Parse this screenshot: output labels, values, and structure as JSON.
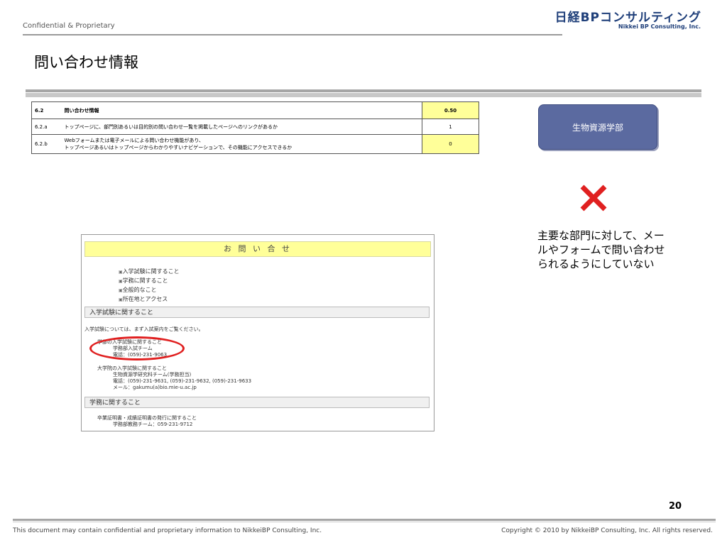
{
  "header": {
    "confidential": "Confidential & Proprietary",
    "logo_jp": "日経BPコンサルティング",
    "logo_en": "Nikkei BP Consulting, Inc."
  },
  "page_title": "問い合わせ情報",
  "criteria": [
    {
      "id": "6.2",
      "text1": "問い合わせ情報",
      "text2": "",
      "score": "0.50"
    },
    {
      "id": "6.2.a",
      "text1": "トップページに、部門別あるいは目的別の問い合わせ一覧を掲載したページへのリンクがあるか",
      "text2": "",
      "score": "1"
    },
    {
      "id": "6.2.b",
      "text1": "Webフォームまたは電子メールによる問い合わせ機能があり、",
      "text2": "トップページあるいはトップページからわかりやすいナビゲーションで、その機能にアクセスできるか",
      "score": "0"
    }
  ],
  "department": "生物資源学部",
  "note": "主要な部門に対して、メールやフォームで問い合わせられるようにしていない",
  "screenshot": {
    "heading": "お 問 い 合 せ",
    "links": [
      "入学試験に関すること",
      "学務に関すること",
      "全般的なこと",
      "所在地とアクセス"
    ],
    "section1": "入学試験に関すること",
    "intro": "入学試験については、まず入試案内をご覧ください。",
    "item1_title": "学部の入学試験に関すること",
    "item1_team": "学務部入試チーム",
    "item1_tel": "電話：(059)-231-9063",
    "item2_title": "大学院の入学試験に関すること",
    "item2_team": "生物資源学研究科チーム(学務担当)",
    "item2_tel": "電話：(059)-231-9631, (059)-231-9632, (059)-231-9633",
    "item2_mail": "メール：gakumu(a)bio.mie-u.ac.jp",
    "section2": "学務に関すること",
    "item3_title": "卒業証明書・成績証明書の発行に関すること",
    "item3_team": "学務部教務チーム：059-231-9712"
  },
  "page_number": "20",
  "footer": {
    "left": "This document may contain confidential and proprietary information to NikkeiBP Consulting, Inc.",
    "right": "Copyright © 2010 by NikkeiBP Consulting, Inc. All rights reserved."
  },
  "colors": {
    "accent": "#5b6aa0",
    "highlight": "#ffff99",
    "mark": "#e02020"
  }
}
